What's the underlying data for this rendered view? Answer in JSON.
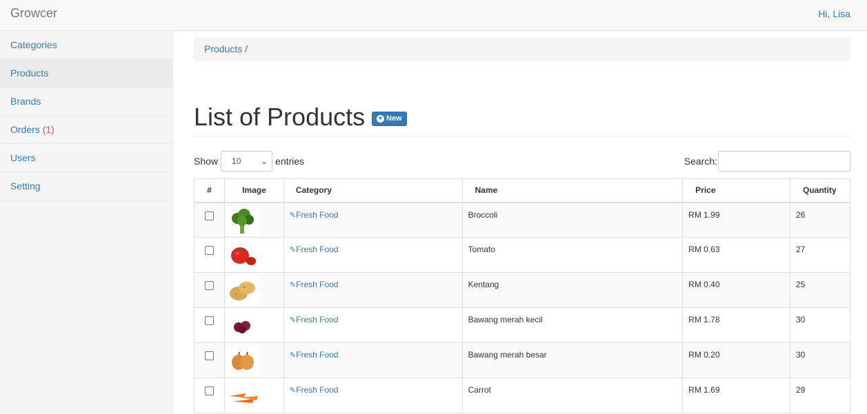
{
  "app": {
    "brand": "Growcer",
    "user_greeting": "Hi, Lisa"
  },
  "sidebar": {
    "items": [
      {
        "label": "Categories",
        "active": false
      },
      {
        "label": "Products",
        "active": true
      },
      {
        "label": "Brands",
        "active": false
      },
      {
        "label": "Orders",
        "count": "(1)",
        "active": false
      },
      {
        "label": "Users",
        "active": false
      },
      {
        "label": "Setting",
        "active": false
      }
    ]
  },
  "breadcrumb": {
    "link": "Products",
    "separator": "/"
  },
  "page": {
    "title": "List of Products",
    "new_button": "New"
  },
  "table_controls": {
    "show_label": "Show",
    "page_length": "10",
    "entries_label": "entries",
    "search_label": "Search:",
    "search_value": ""
  },
  "table": {
    "columns": [
      "#",
      "Image",
      "Category",
      "Name",
      "Price",
      "Quantity"
    ],
    "rows": [
      {
        "category": "Fresh Food",
        "name": "Broccoli",
        "price": "RM 1.99",
        "quantity": "26",
        "image": "broccoli"
      },
      {
        "category": "Fresh Food",
        "name": "Tomato",
        "price": "RM 0.63",
        "quantity": "27",
        "image": "tomato"
      },
      {
        "category": "Fresh Food",
        "name": "Kentang",
        "price": "RM 0.40",
        "quantity": "25",
        "image": "potato"
      },
      {
        "category": "Fresh Food",
        "name": "Bawang merah kecil",
        "price": "RM 1.78",
        "quantity": "30",
        "image": "red-onion"
      },
      {
        "category": "Fresh Food",
        "name": "Bawang merah besar",
        "price": "RM 0.20",
        "quantity": "30",
        "image": "onion"
      },
      {
        "category": "Fresh Food",
        "name": "Carrot",
        "price": "RM 1.69",
        "quantity": "29",
        "image": "carrot"
      }
    ]
  },
  "colors": {
    "link": "#337ab7",
    "badge_count": "#d9534f",
    "primary_button": "#337ab7"
  }
}
